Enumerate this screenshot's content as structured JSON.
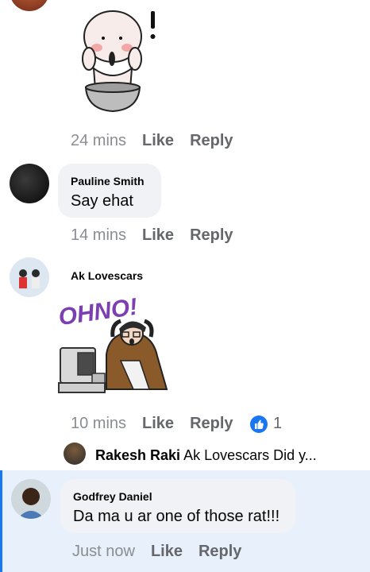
{
  "comments": [
    {
      "id": "sticker-comment",
      "meta": {
        "time": "24 mins",
        "like": "Like",
        "reply": "Reply"
      }
    },
    {
      "id": "pauline",
      "author": "Pauline Smith",
      "text": "Say ehat",
      "meta": {
        "time": "14 mins",
        "like": "Like",
        "reply": "Reply"
      }
    },
    {
      "id": "ak",
      "author": "Ak Lovescars",
      "sticker_text": "OHNO!",
      "meta": {
        "time": "10 mins",
        "like": "Like",
        "reply": "Reply",
        "reaction_count": "1"
      }
    },
    {
      "id": "godfrey",
      "author": "Godfrey Daniel",
      "text": "Da ma u ar one of those rat!!!",
      "meta": {
        "time": "Just now",
        "like": "Like",
        "reply": "Reply"
      }
    }
  ],
  "reply_preview": {
    "author": "Rakesh Raki",
    "text": "Ak Lovescars Did y..."
  },
  "colors": {
    "accent": "#1877f2",
    "highlight": "#e7f0fb",
    "bubble": "#f0f2f5",
    "meta_text": "#8a8d91"
  },
  "icons": [
    "like-reaction-icon"
  ]
}
